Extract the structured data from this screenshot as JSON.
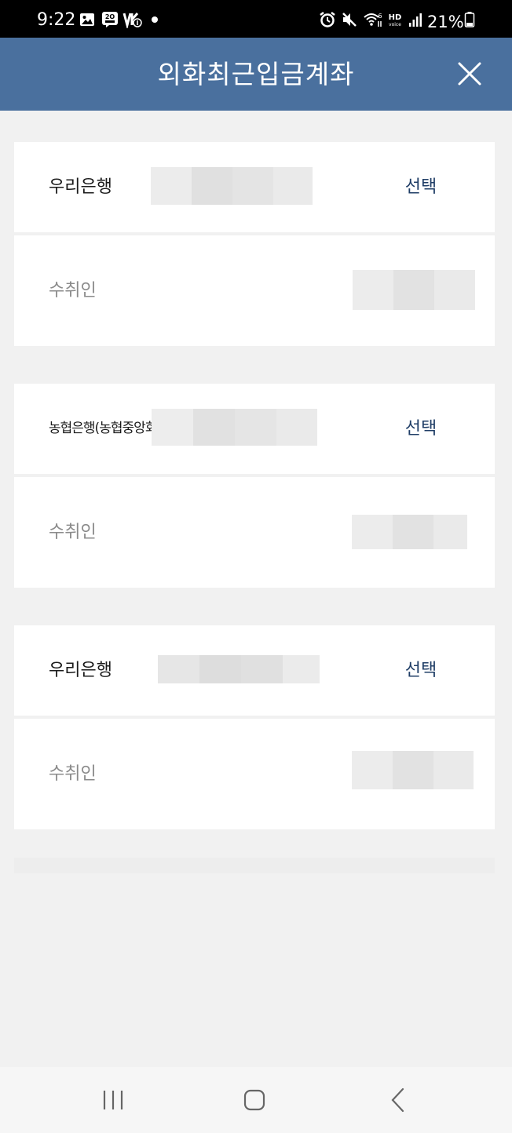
{
  "status_bar": {
    "time": "9:22",
    "battery_percent": "21%",
    "icons": [
      "gallery-icon",
      "sports-app-icon",
      "volte-icon",
      "notification-dot-icon",
      "alarm-icon",
      "mute-icon",
      "wifi-6-icon",
      "hd-voice-icon",
      "signal-icon",
      "battery-icon"
    ]
  },
  "header": {
    "title": "외화최근입금계좌",
    "close_icon": "close-icon"
  },
  "accounts": [
    {
      "bank_name": "우리은행",
      "select_label": "선택",
      "recipient_label": "수취인"
    },
    {
      "bank_name": "농협은행(농협중앙회)",
      "select_label": "선택",
      "recipient_label": "수취인"
    },
    {
      "bank_name": "우리은행",
      "select_label": "선택",
      "recipient_label": "수취인"
    }
  ],
  "nav_bar": {
    "icons": [
      "recent-apps-icon",
      "home-icon",
      "back-icon"
    ]
  },
  "colors": {
    "header_bg": "#4a709e",
    "select_text": "#1f3d66",
    "page_bg": "#f1f1f1"
  }
}
